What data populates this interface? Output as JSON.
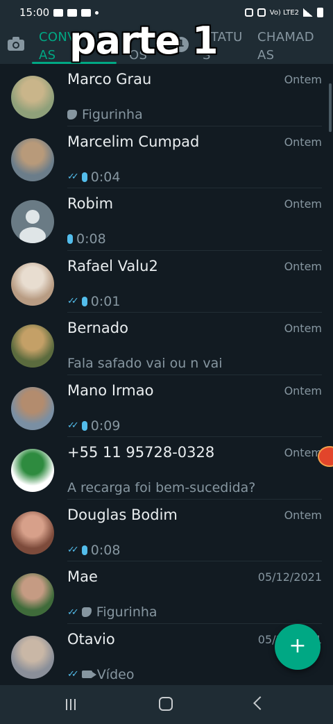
{
  "status_bar": {
    "time": "15:00",
    "network": "Vo) LTE2"
  },
  "overlay_text": "parte 1",
  "tabs": [
    {
      "label": "CONVERSAS",
      "line1": "CONV",
      "line2": "AS",
      "active": true
    },
    {
      "label": "GRUPOS",
      "line1": "",
      "line2": "OS",
      "active": false
    },
    {
      "label": "STATUS",
      "line1": "STATU",
      "line2": "S",
      "active": false
    },
    {
      "label": "CHAMADAS",
      "line1": "CHAMAD",
      "line2": "AS",
      "active": false
    }
  ],
  "tab_badge": "1",
  "chats": [
    {
      "name": "Marco Grau",
      "time": "Ontem",
      "preview": "Figurinha",
      "kind": "sticker",
      "ticks": false,
      "avatar_colors": [
        "#8fa07a",
        "#c9b58a"
      ]
    },
    {
      "name": "Marcelim Cumpad",
      "time": "Ontem",
      "preview": "0:04",
      "kind": "audio",
      "ticks": true,
      "avatar_colors": [
        "#6b7d8a",
        "#b89a7a"
      ]
    },
    {
      "name": "Robim",
      "time": "Ontem",
      "preview": "0:08",
      "kind": "audio",
      "ticks": false,
      "avatar_colors": [
        "#6a7b85",
        "#dfe5e7"
      ]
    },
    {
      "name": "Rafael Valu2",
      "time": "Ontem",
      "preview": "0:01",
      "kind": "audio",
      "ticks": true,
      "avatar_colors": [
        "#b89c83",
        "#e8ddd0"
      ]
    },
    {
      "name": "Bernado",
      "time": "Ontem",
      "preview": "Fala safado vai ou n vai",
      "kind": "text",
      "ticks": false,
      "avatar_colors": [
        "#5b6b3e",
        "#c4a067"
      ]
    },
    {
      "name": "Mano Irmao",
      "time": "Ontem",
      "preview": "0:09",
      "kind": "audio",
      "ticks": true,
      "avatar_colors": [
        "#7a8fa3",
        "#b38c6e"
      ]
    },
    {
      "name": "+55 11 95728-0328",
      "time": "Ontem",
      "preview": "A recarga foi bem-sucedida?",
      "kind": "text",
      "ticks": false,
      "avatar_colors": [
        "#ffffff",
        "#2e8b3f"
      ]
    },
    {
      "name": "Douglas Bodim",
      "time": "Ontem",
      "preview": "0:08",
      "kind": "audio",
      "ticks": true,
      "avatar_colors": [
        "#7d4b3b",
        "#d7a08a"
      ]
    },
    {
      "name": "Mae",
      "time": "05/12/2021",
      "preview": "Figurinha",
      "kind": "sticker",
      "ticks": true,
      "avatar_colors": [
        "#3f6b3a",
        "#c59b83"
      ]
    },
    {
      "name": "Otavio",
      "time": "05/12/2021",
      "preview": "Vídeo",
      "kind": "video",
      "ticks": true,
      "avatar_colors": [
        "#8a8f99",
        "#c9b7a6"
      ]
    }
  ],
  "colors": {
    "accent": "#00a884",
    "background": "#121b22",
    "header": "#1f2c34",
    "read_ticks": "#53bdeb"
  },
  "fab_icon": "+"
}
